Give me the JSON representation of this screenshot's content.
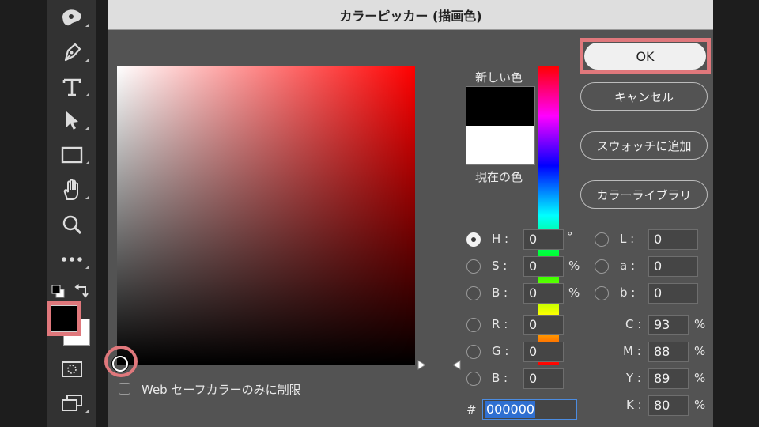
{
  "dialog": {
    "title": "カラーピッカー (描画色)",
    "ok_label": "OK",
    "cancel_label": "キャンセル",
    "add_swatch_label": "スウォッチに追加",
    "color_library_label": "カラーライブラリ",
    "new_color_label": "新しい色",
    "current_color_label": "現在の色",
    "new_color": "#000000",
    "current_color": "#ffffff",
    "hue_color": "#ff0000",
    "web_safe_label": "Web セーフカラーのみに制限",
    "hex_label": "#",
    "hex_value": "000000"
  },
  "fields": {
    "H": {
      "label": "H :",
      "value": "0",
      "unit": "°"
    },
    "S": {
      "label": "S :",
      "value": "0",
      "unit": "%"
    },
    "Bv": {
      "label": "B :",
      "value": "0",
      "unit": "%"
    },
    "R": {
      "label": "R :",
      "value": "0"
    },
    "G": {
      "label": "G :",
      "value": "0"
    },
    "B": {
      "label": "B :",
      "value": "0"
    },
    "L": {
      "label": "L :",
      "value": "0"
    },
    "a": {
      "label": "a :",
      "value": "0"
    },
    "b": {
      "label": "b :",
      "value": "0"
    },
    "C": {
      "label": "C :",
      "value": "93",
      "unit": "%"
    },
    "M": {
      "label": "M :",
      "value": "88",
      "unit": "%"
    },
    "Y": {
      "label": "Y :",
      "value": "89",
      "unit": "%"
    },
    "K": {
      "label": "K :",
      "value": "80",
      "unit": "%"
    }
  },
  "toolbar": {
    "tools": [
      "smudge-icon",
      "pen-icon",
      "type-icon",
      "path-selection-icon",
      "rectangle-icon",
      "hand-icon",
      "zoom-icon",
      "more-icon"
    ],
    "foreground": "#000000",
    "background": "#ffffff"
  },
  "highlight_color": "#e0787c"
}
